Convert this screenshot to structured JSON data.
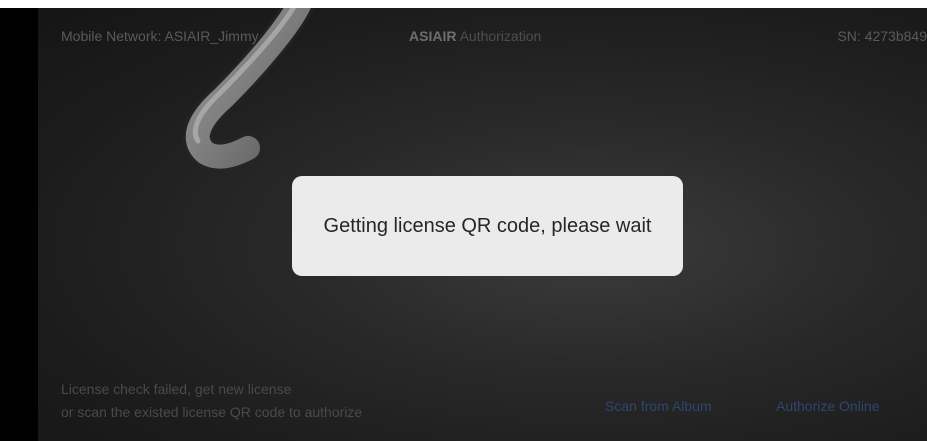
{
  "header": {
    "mobile_network": "Mobile Network: ASIAIR_Jimmy",
    "title_brand": "ASIAIR",
    "title_rest": "Authorization",
    "serial": "SN: 4273b849"
  },
  "toast": {
    "message": "Getting license QR code, please wait"
  },
  "footer": {
    "license_line1": "License check failed, get new license",
    "license_line2": "or scan the existed license QR code to authorize",
    "scan_from_album": "Scan from Album",
    "authorize_online": "Authorize Online"
  },
  "colors": {
    "link_blue": "#2f4570",
    "toast_bg": "#ebebeb"
  }
}
